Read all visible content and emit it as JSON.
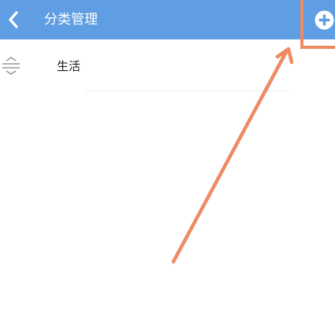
{
  "header": {
    "title": "分类管理",
    "back_icon": "chevron-left-icon",
    "add_icon": "plus-circle-icon",
    "background_color": "#5f9ee2"
  },
  "categories": [
    {
      "label": "生活",
      "handle_icon": "drag-handle-icon"
    }
  ],
  "annotation": {
    "color": "#ef8a62"
  }
}
